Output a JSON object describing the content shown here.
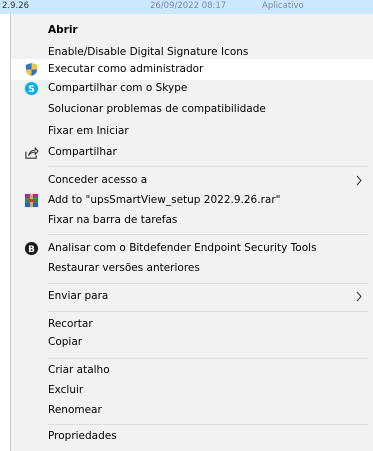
{
  "background": {
    "left_fragment": "2.9.26",
    "date_fragment": "26/09/2022 08:17",
    "type_fragment": "Aplicativo"
  },
  "menu": {
    "items": [
      {
        "label": "Abrir",
        "bold": true,
        "icon": null
      },
      {
        "label": "Enable/Disable Digital Signature Icons",
        "icon": null
      },
      {
        "label": "Executar como administrador",
        "icon": "uac-shield-icon",
        "highlighted": true
      },
      {
        "label": "Compartilhar com o Skype",
        "icon": "skype-icon"
      },
      {
        "label": "Solucionar problemas de compatibilidade",
        "icon": null
      },
      {
        "label": "Fixar em Iniciar",
        "icon": null
      },
      {
        "label": "Compartilhar",
        "icon": "share-icon"
      },
      {
        "label": "Conceder acesso a",
        "icon": null,
        "submenu": true
      },
      {
        "label": "Add to \"upsSmartView_setup 2022.9.26.rar\"",
        "icon": "winrar-icon"
      },
      {
        "label": "Fixar na barra de tarefas",
        "icon": null
      },
      {
        "label": "Analisar com o Bitdefender Endpoint Security Tools",
        "icon": "bitdefender-icon"
      },
      {
        "label": "Restaurar versões anteriores",
        "icon": null
      },
      {
        "label": "Enviar para",
        "icon": null,
        "submenu": true
      },
      {
        "label": "Recortar",
        "icon": null
      },
      {
        "label": "Copiar",
        "icon": null
      },
      {
        "label": "Criar atalho",
        "icon": null
      },
      {
        "label": "Excluir",
        "icon": null
      },
      {
        "label": "Renomear",
        "icon": null
      },
      {
        "label": "Propriedades",
        "icon": null
      }
    ]
  },
  "colors": {
    "menu_bg": "#f2f2f2",
    "hover_bg": "#ffffff",
    "selection_bg": "#cce8ff",
    "skype": "#00aff0",
    "bitdefender": "#1a1a1a"
  }
}
